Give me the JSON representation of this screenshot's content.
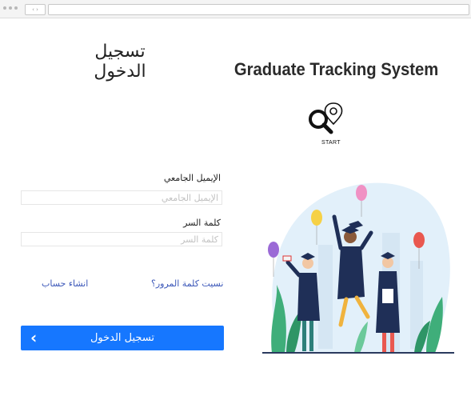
{
  "browser": {
    "nav_glyph": "‹ ›"
  },
  "login": {
    "title": "تسجيل الدخول",
    "email_label": "الإيميل الجامعي",
    "email_placeholder": "الإيميل الجامعي",
    "email_value": "",
    "password_label": "كلمة السر",
    "password_placeholder": "كلمة السر",
    "password_value": "",
    "forgot_link": "نسيت كلمة المرور؟",
    "create_account_link": "انشاء حساب",
    "submit_label": "تسجيل الدخول",
    "submit_icon": "chevron-left-icon"
  },
  "brand": {
    "title": "Graduate Tracking System",
    "logo_icon": "search-location-icon",
    "logo_caption": "START"
  },
  "colors": {
    "primary": "#1677ff",
    "link": "#3a56b8",
    "illustration_blob": "#e2f0fa",
    "gown": "#1f2f57"
  }
}
